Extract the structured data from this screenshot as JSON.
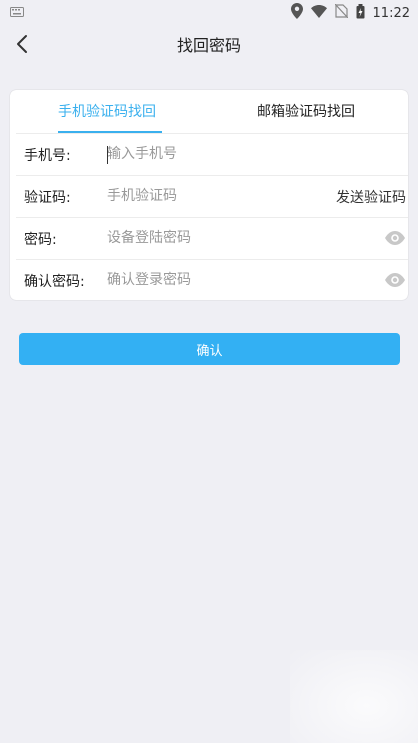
{
  "status_bar": {
    "time": "11:22"
  },
  "nav": {
    "title": "找回密码"
  },
  "tabs": {
    "phone": "手机验证码找回",
    "email": "邮箱验证码找回"
  },
  "form": {
    "phone": {
      "label": "手机号:",
      "placeholder": "输入手机号"
    },
    "code": {
      "label": "验证码:",
      "placeholder": "手机验证码",
      "send": "发送验证码"
    },
    "password": {
      "label": "密码:",
      "placeholder": "设备登陆密码"
    },
    "confirm_password": {
      "label": "确认密码:",
      "placeholder": "确认登录密码"
    }
  },
  "confirm_button": "确认",
  "colors": {
    "accent": "#3ab0ee",
    "button": "#33b0f3",
    "background": "#efeff4"
  },
  "icons": [
    "keyboard-icon",
    "location-icon",
    "wifi-icon",
    "no-sim-icon",
    "battery-icon",
    "back-arrow-icon",
    "eye-icon"
  ]
}
